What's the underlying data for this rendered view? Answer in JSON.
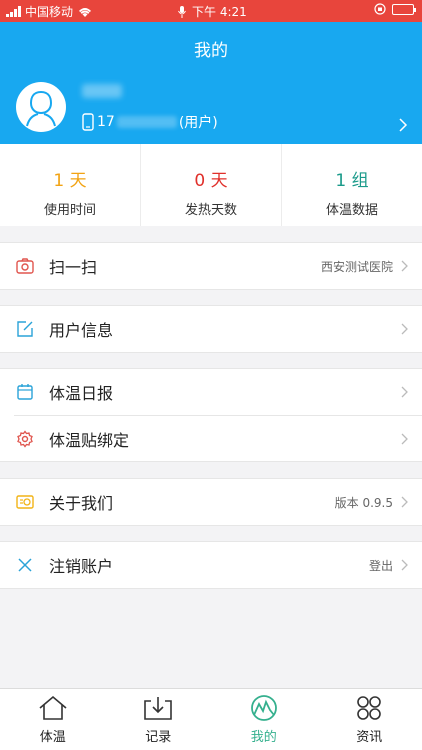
{
  "status_bar": {
    "carrier": "中国移动",
    "time": "下午 4:21"
  },
  "header": {
    "title": "我的",
    "phone_prefix": "17",
    "role": "(用户)"
  },
  "stats": [
    {
      "value": "1 天",
      "label": "使用时间",
      "color": "#f2a313"
    },
    {
      "value": "0 天",
      "label": "发热天数",
      "color": "#e0302b"
    },
    {
      "value": "1 组",
      "label": "体温数据",
      "color": "#1a9a8a"
    }
  ],
  "menu": {
    "scan": {
      "label": "扫一扫",
      "right": "西安测试医院"
    },
    "user_info": {
      "label": "用户信息"
    },
    "daily_report": {
      "label": "体温日报"
    },
    "patch_bind": {
      "label": "体温贴绑定"
    },
    "about": {
      "label": "关于我们",
      "right": "版本 0.9.5"
    },
    "logout_account": {
      "label": "注销账户",
      "right": "登出"
    }
  },
  "icon_colors": {
    "scan": "#e0554e",
    "user_info": "#2aa3d8",
    "daily_report": "#2aa3d8",
    "patch_bind": "#e0554e",
    "about": "#f2b417",
    "logout": "#2aa3d8"
  },
  "tabs": [
    {
      "label": "体温",
      "icon": "home-icon"
    },
    {
      "label": "记录",
      "icon": "download-tray-icon"
    },
    {
      "label": "我的",
      "icon": "mountain-logo-icon",
      "active": true
    },
    {
      "label": "资讯",
      "icon": "four-circles-icon"
    }
  ]
}
